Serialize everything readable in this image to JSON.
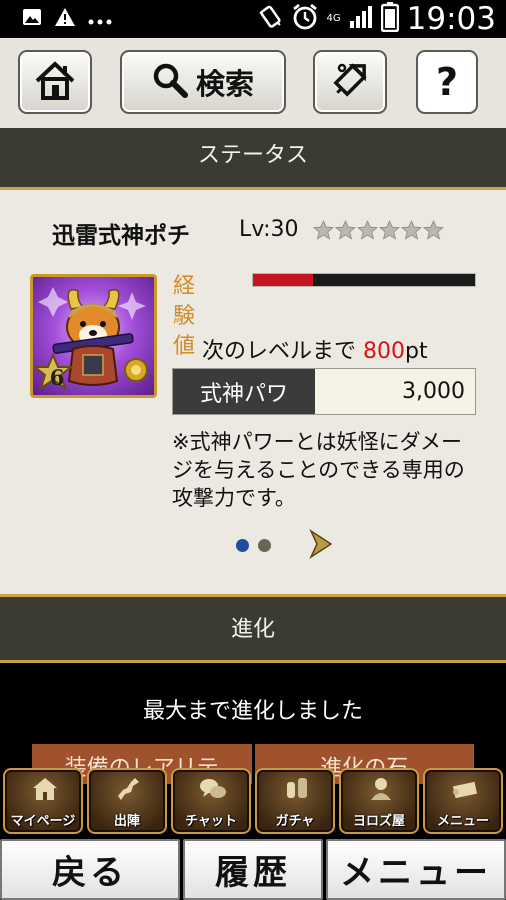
{
  "status_bar": {
    "time": "19:03",
    "network": "4G",
    "icons": [
      "image-icon",
      "warning-icon",
      "more-icon",
      "vibrate-icon",
      "alarm-icon",
      "signal-icon",
      "battery-icon"
    ]
  },
  "top_nav": {
    "home_icon": "home-icon",
    "search_label": "検索",
    "tag_icon": "tag-icon",
    "help_label": "?"
  },
  "status_section": {
    "title": "ステータス",
    "name": "迅雷式神ポチ",
    "level": "Lv:30",
    "stars_total": 6,
    "stars_filled": 0,
    "rarity_badge": "6",
    "exp_label": "経験値",
    "exp_progress": 0.27,
    "next_level_prefix": "次のレベルまで",
    "next_level_value": "800",
    "next_level_suffix": "pt",
    "power_label": "式神パワ",
    "power_value": "3,000",
    "note": "※式神パワーとは妖怪にダメージを与えることのできる専用の攻撃力です。",
    "page_count": 2,
    "page_active": 1
  },
  "evolution_section": {
    "title": "進化",
    "message": "最大まで進化しました",
    "tabs": [
      "装備のレアリテ",
      "進化の石"
    ]
  },
  "game_menu": [
    {
      "label": "マイページ",
      "icon": "mypage-icon"
    },
    {
      "label": "出陣",
      "icon": "map-icon"
    },
    {
      "label": "チャット",
      "icon": "chat-icon"
    },
    {
      "label": "ガチャ",
      "icon": "gacha-icon"
    },
    {
      "label": "ヨロズ屋",
      "icon": "shop-icon"
    },
    {
      "label": "メニュー",
      "icon": "scroll-icon"
    }
  ],
  "bottom_bar": {
    "back_label": "戻る",
    "history_label": "履歴",
    "menu_label": "メニュー"
  },
  "colors": {
    "section_bg": "#3b3b32",
    "panel_bg": "#ebe9e1",
    "accent_gold": "#c9a24a",
    "exp_fill": "#c4141e",
    "highlight_red": "#d9121b",
    "exp_label": "#d38c2a"
  }
}
